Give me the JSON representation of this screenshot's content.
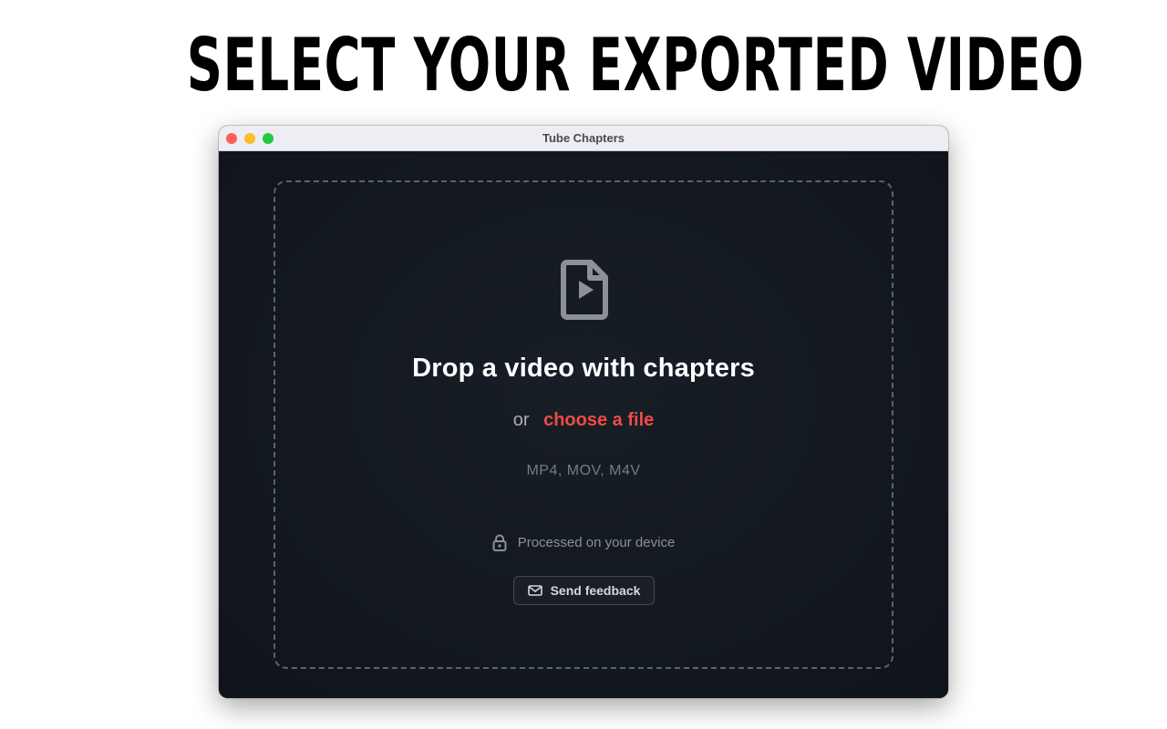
{
  "headline": "SELECT YOUR EXPORTED VIDEO",
  "window": {
    "title": "Tube Chapters"
  },
  "dropzone": {
    "icon": "video-file-icon",
    "title": "Drop a video with chapters",
    "or_text": "or",
    "choose_link": "choose a file",
    "formats": "MP4, MOV, M4V",
    "privacy_icon": "lock-icon",
    "privacy_text": "Processed on your device",
    "feedback_icon": "mail-icon",
    "feedback_label": "Send feedback"
  },
  "colors": {
    "accent": "#ee4b45",
    "window_bg": "#13181f",
    "close": "#ff5f57",
    "minimize": "#febc2e",
    "maximize": "#28c840"
  }
}
